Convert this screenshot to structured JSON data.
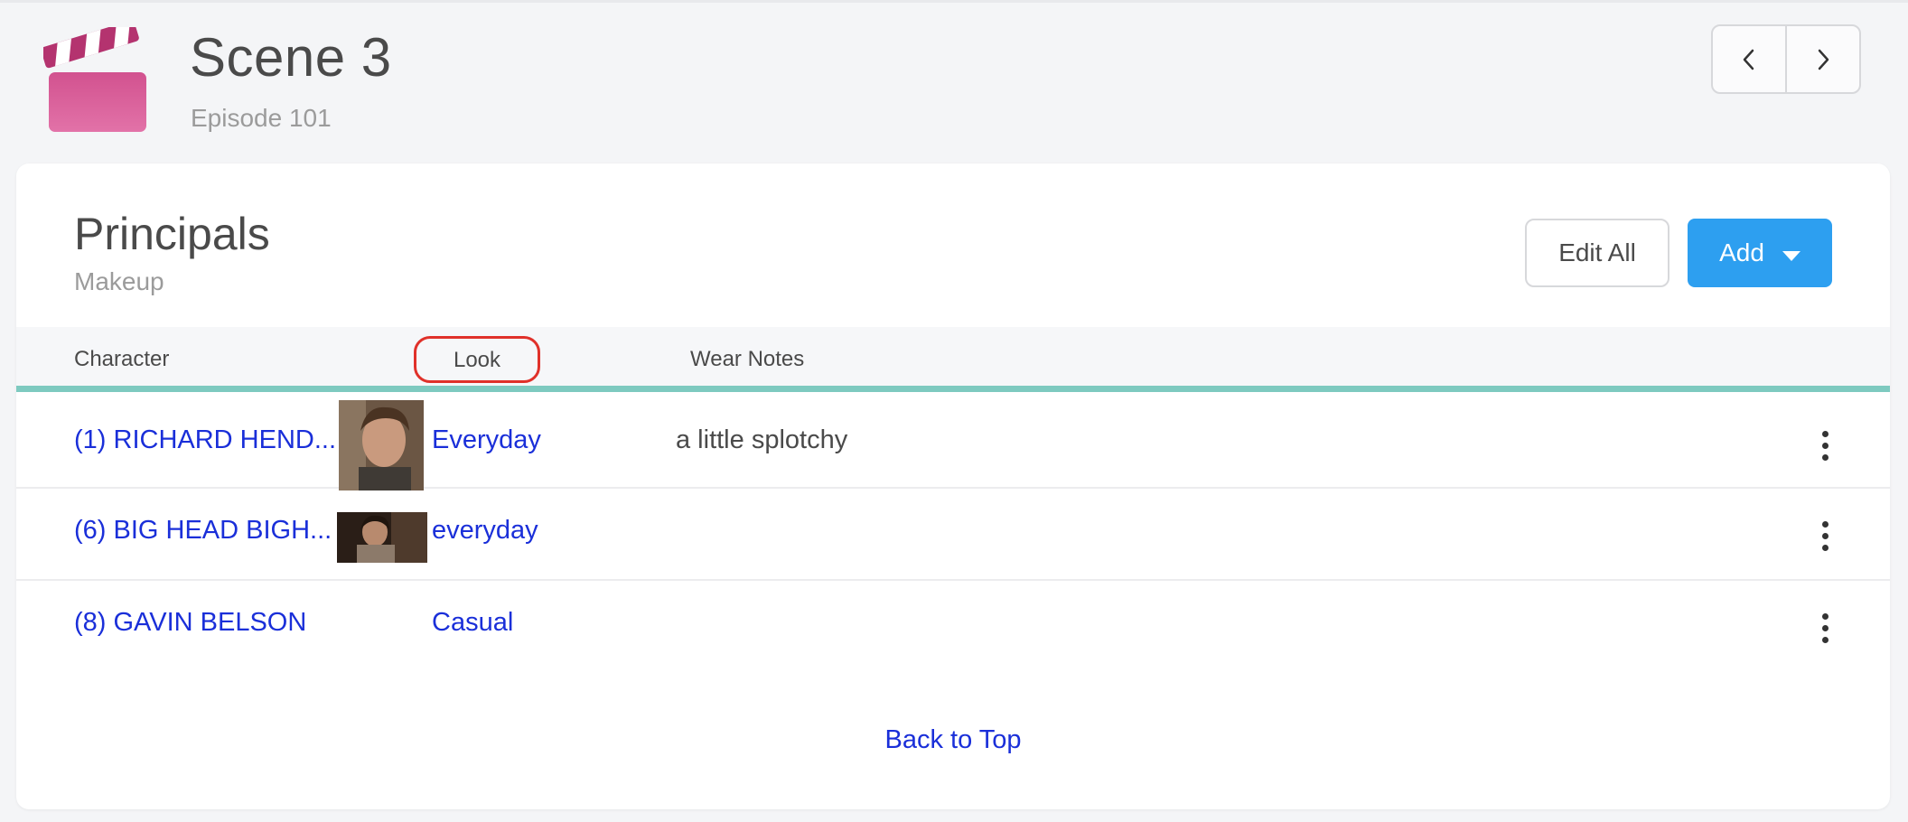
{
  "header": {
    "title": "Scene 3",
    "subtitle": "Episode 101",
    "icon": "clapperboard-icon",
    "brand_color": "#d9609d",
    "prev_icon": "chevron-left-icon",
    "next_icon": "chevron-right-icon"
  },
  "section": {
    "title": "Principals",
    "subtitle": "Makeup",
    "edit_label": "Edit All",
    "add_label": "Add",
    "accent": "#2d9ff0"
  },
  "table": {
    "columns": {
      "character": "Character",
      "look": "Look",
      "notes": "Wear Notes"
    },
    "rows": [
      {
        "character": "(1) RICHARD HEND...",
        "look": "Everyday",
        "notes": "a little splotchy",
        "has_photo": true
      },
      {
        "character": "(6) BIG HEAD BIGH...",
        "look": "everyday",
        "notes": "",
        "has_photo": true
      },
      {
        "character": "(8) GAVIN BELSON",
        "look": "Casual",
        "notes": "",
        "has_photo": false
      }
    ]
  },
  "footer": {
    "back_to_top": "Back to Top"
  }
}
